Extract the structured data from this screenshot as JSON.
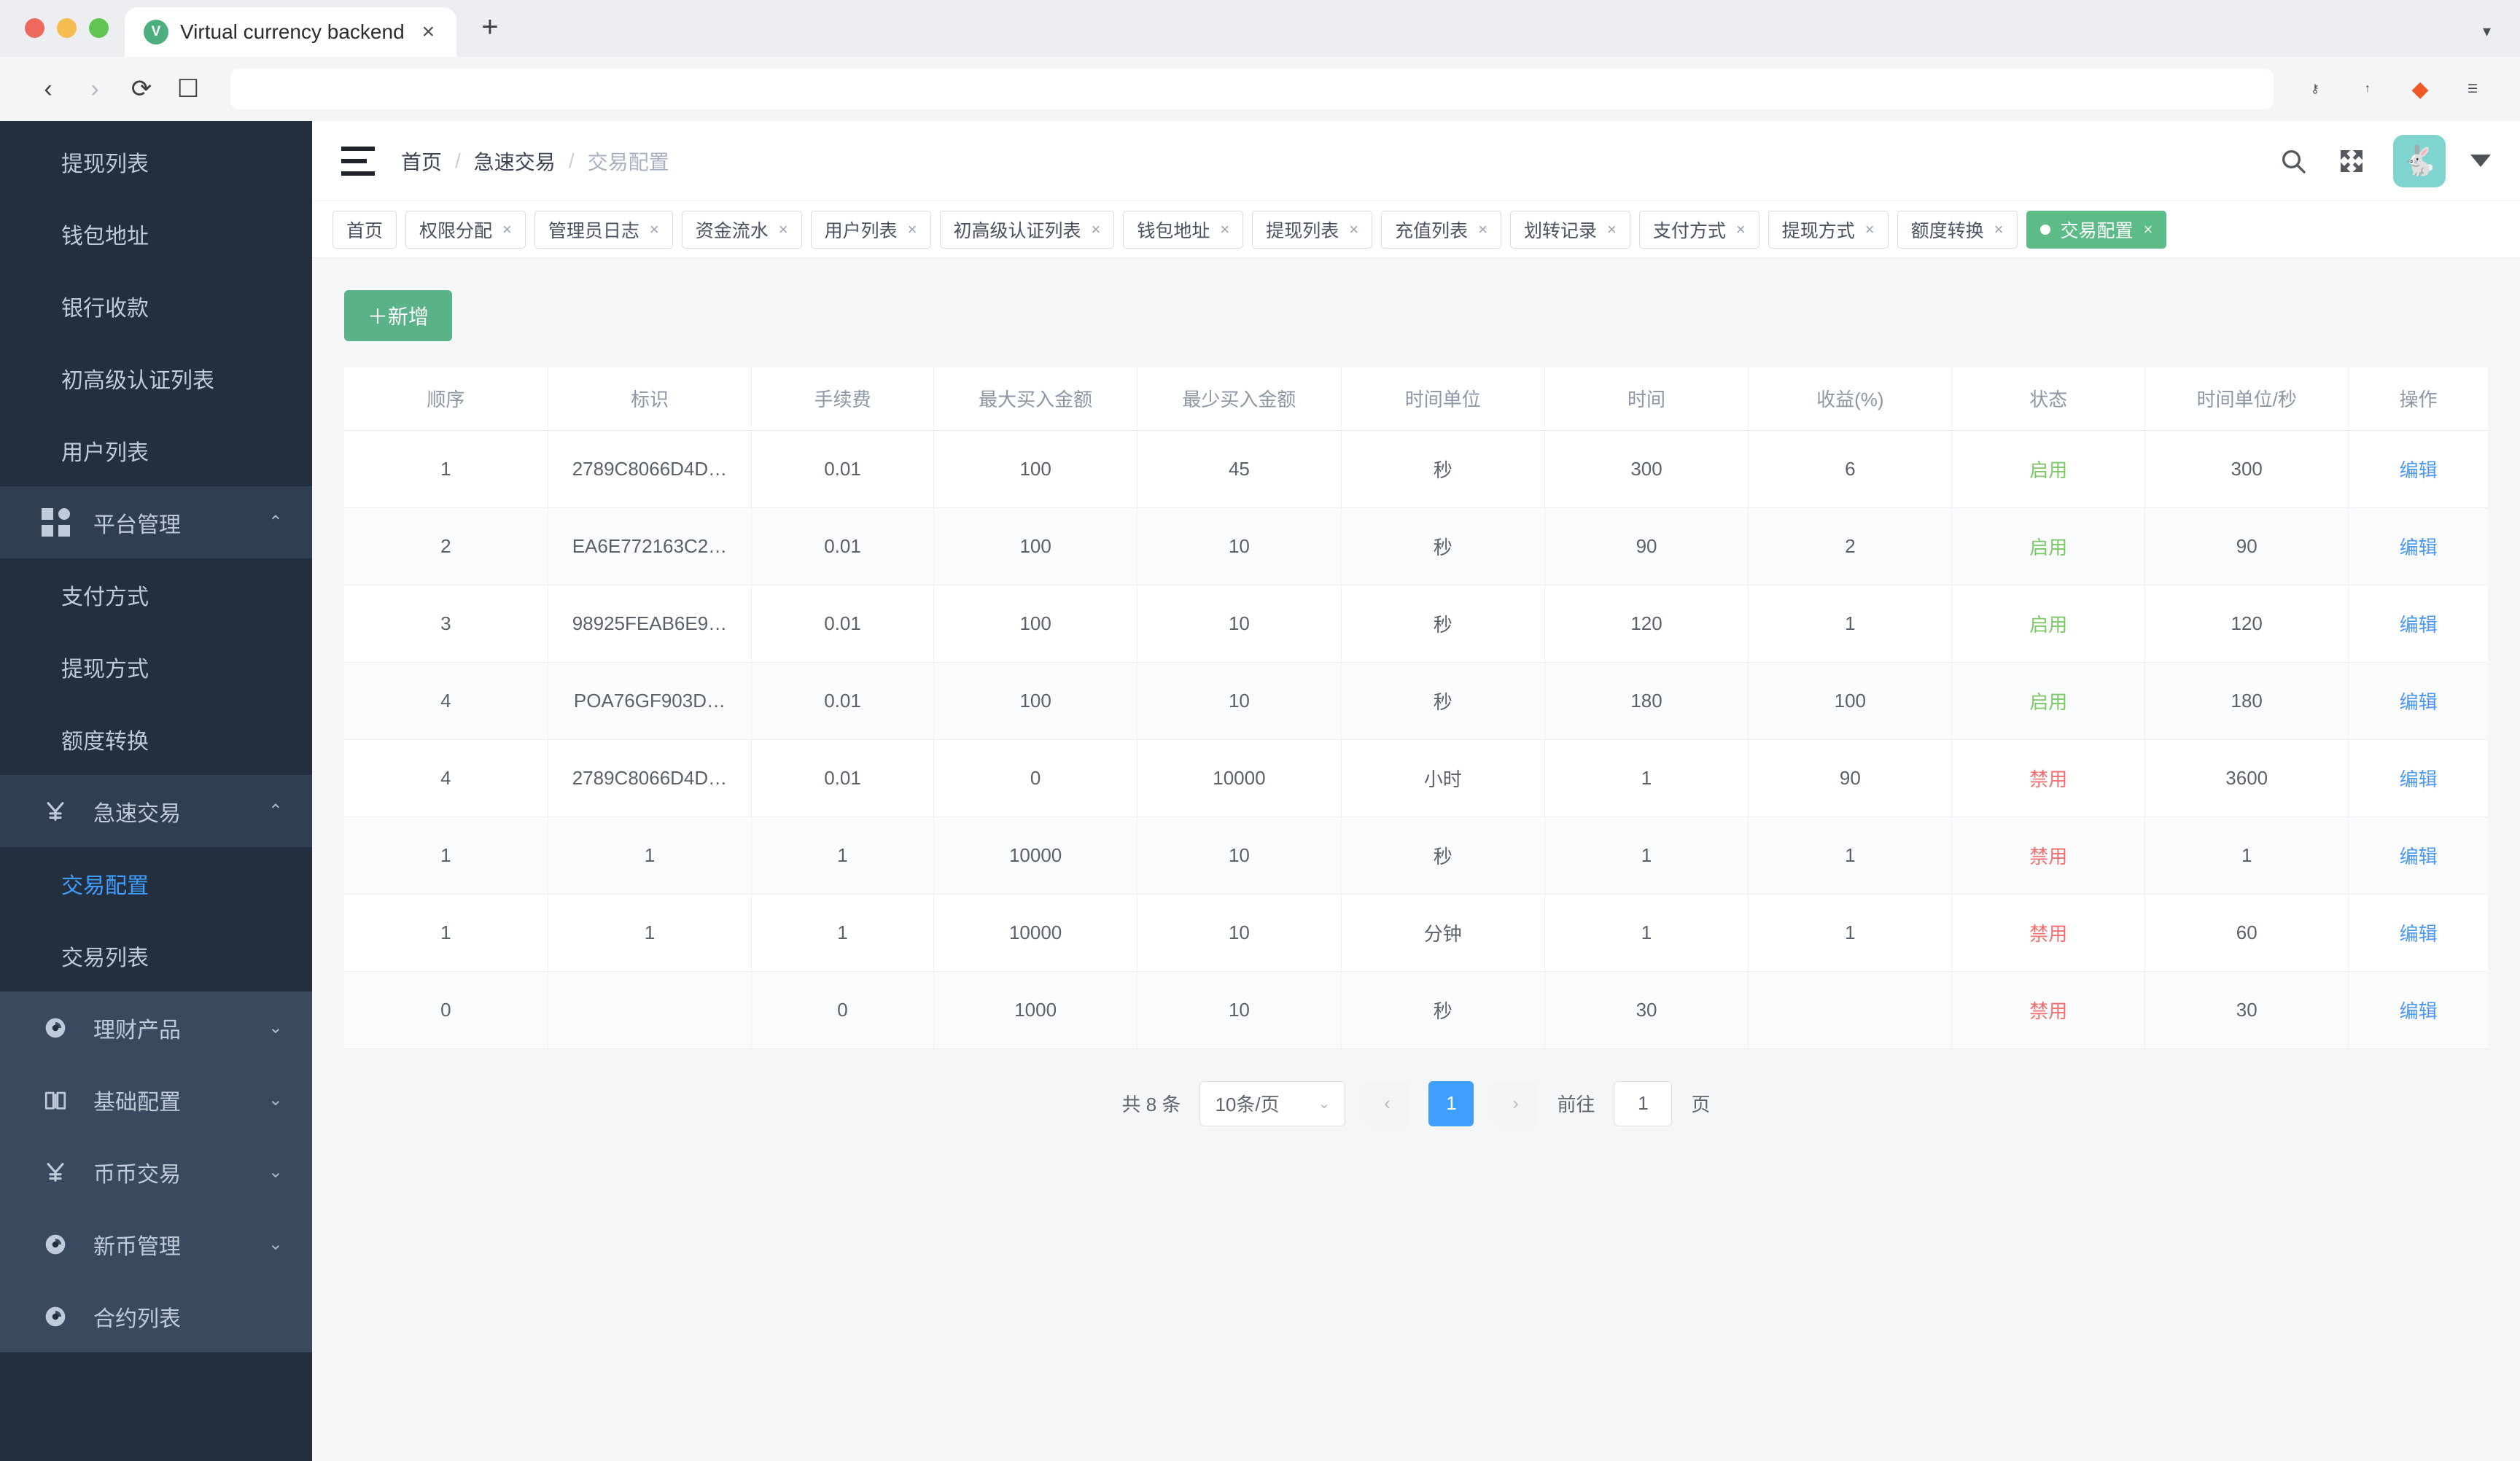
{
  "browser": {
    "tab_title": "Virtual currency backend",
    "favicon_letter": "V",
    "tab_close": "×",
    "new_tab": "+",
    "window_chevron": "▾",
    "back_icon": "‹",
    "forward_icon": "›",
    "reload_icon": "⟳",
    "bookmark_icon": "☐",
    "url_value": "",
    "key_icon": "⚷",
    "share_icon": "↑",
    "brave_icon": "◆",
    "menu_icon": "☰"
  },
  "sidebar": {
    "items": [
      {
        "label": "提现列表",
        "type": "sub"
      },
      {
        "label": "钱包地址",
        "type": "sub"
      },
      {
        "label": "银行收款",
        "type": "sub"
      },
      {
        "label": "初高级认证列表",
        "type": "sub"
      },
      {
        "label": "用户列表",
        "type": "sub"
      },
      {
        "label": "平台管理",
        "type": "group",
        "icon": "grid-icon",
        "arrow": "⌃"
      },
      {
        "label": "支付方式",
        "type": "sub"
      },
      {
        "label": "提现方式",
        "type": "sub"
      },
      {
        "label": "额度转换",
        "type": "sub"
      },
      {
        "label": "急速交易",
        "type": "group",
        "icon": "yen-icon",
        "arrow": "⌃"
      },
      {
        "label": "交易配置",
        "type": "sub",
        "active": true
      },
      {
        "label": "交易列表",
        "type": "sub"
      },
      {
        "label": "理财产品",
        "type": "group-collapsed",
        "icon": "pie-icon",
        "arrow": "⌄"
      },
      {
        "label": "基础配置",
        "type": "group-collapsed",
        "icon": "book-icon",
        "arrow": "⌄"
      },
      {
        "label": "币币交易",
        "type": "group-collapsed",
        "icon": "yen-icon",
        "arrow": "⌄"
      },
      {
        "label": "新币管理",
        "type": "group-collapsed",
        "icon": "pie-icon",
        "arrow": "⌄"
      },
      {
        "label": "合约列表",
        "type": "group-collapsed",
        "icon": "pie-icon",
        "arrow": ""
      }
    ]
  },
  "topbar": {
    "breadcrumb": [
      "首页",
      "急速交易",
      "交易配置"
    ],
    "separator": "/",
    "search_icon": "⚲",
    "fullscreen_icon": "⛶",
    "avatar_icon": "🐇",
    "avatar_color": "#7fd4d0"
  },
  "view_tabs": {
    "items": [
      {
        "label": "首页",
        "closable": false,
        "active": false
      },
      {
        "label": "权限分配",
        "closable": true,
        "active": false
      },
      {
        "label": "管理员日志",
        "closable": true,
        "active": false
      },
      {
        "label": "资金流水",
        "closable": true,
        "active": false
      },
      {
        "label": "用户列表",
        "closable": true,
        "active": false
      },
      {
        "label": "初高级认证列表",
        "closable": true,
        "active": false
      },
      {
        "label": "钱包地址",
        "closable": true,
        "active": false
      },
      {
        "label": "提现列表",
        "closable": true,
        "active": false
      },
      {
        "label": "充值列表",
        "closable": true,
        "active": false
      },
      {
        "label": "划转记录",
        "closable": true,
        "active": false
      },
      {
        "label": "支付方式",
        "closable": true,
        "active": false
      },
      {
        "label": "提现方式",
        "closable": true,
        "active": false
      },
      {
        "label": "额度转换",
        "closable": true,
        "active": false
      },
      {
        "label": "交易配置",
        "closable": true,
        "active": true
      }
    ],
    "close_glyph": "×",
    "active_color": "#5dbb87"
  },
  "toolbar": {
    "add_label": "＋新增",
    "add_color": "#5ab288"
  },
  "table": {
    "columns": [
      "顺序",
      "标识",
      "手续费",
      "最大买入金额",
      "最少买入金额",
      "时间单位",
      "时间",
      "收益(%)",
      "状态",
      "时间单位/秒",
      "操作"
    ],
    "rows": [
      {
        "order": "1",
        "id": "2789C8066D4D…",
        "fee": "0.01",
        "max_buy": "100",
        "min_buy": "45",
        "unit": "秒",
        "time": "300",
        "profit": "6",
        "status": "启用",
        "status_type": "on",
        "unit_sec": "300",
        "action": "编辑"
      },
      {
        "order": "2",
        "id": "EA6E772163C2…",
        "fee": "0.01",
        "max_buy": "100",
        "min_buy": "10",
        "unit": "秒",
        "time": "90",
        "profit": "2",
        "status": "启用",
        "status_type": "on",
        "unit_sec": "90",
        "action": "编辑"
      },
      {
        "order": "3",
        "id": "98925FEAB6E9…",
        "fee": "0.01",
        "max_buy": "100",
        "min_buy": "10",
        "unit": "秒",
        "time": "120",
        "profit": "1",
        "status": "启用",
        "status_type": "on",
        "unit_sec": "120",
        "action": "编辑"
      },
      {
        "order": "4",
        "id": "POA76GF903D…",
        "fee": "0.01",
        "max_buy": "100",
        "min_buy": "10",
        "unit": "秒",
        "time": "180",
        "profit": "100",
        "status": "启用",
        "status_type": "on",
        "unit_sec": "180",
        "action": "编辑"
      },
      {
        "order": "4",
        "id": "2789C8066D4D…",
        "fee": "0.01",
        "max_buy": "0",
        "min_buy": "10000",
        "unit": "小时",
        "time": "1",
        "profit": "90",
        "status": "禁用",
        "status_type": "off",
        "unit_sec": "3600",
        "action": "编辑"
      },
      {
        "order": "1",
        "id": "1",
        "fee": "1",
        "max_buy": "10000",
        "min_buy": "10",
        "unit": "秒",
        "time": "1",
        "profit": "1",
        "status": "禁用",
        "status_type": "off",
        "unit_sec": "1",
        "action": "编辑"
      },
      {
        "order": "1",
        "id": "1",
        "fee": "1",
        "max_buy": "10000",
        "min_buy": "10",
        "unit": "分钟",
        "time": "1",
        "profit": "1",
        "status": "禁用",
        "status_type": "off",
        "unit_sec": "60",
        "action": "编辑"
      },
      {
        "order": "0",
        "id": "",
        "fee": "0",
        "max_buy": "1000",
        "min_buy": "10",
        "unit": "秒",
        "time": "30",
        "profit": "",
        "status": "禁用",
        "status_type": "off",
        "unit_sec": "30",
        "action": "编辑"
      }
    ]
  },
  "pagination": {
    "total_label": "共 8 条",
    "page_size": "10条/页",
    "prev": "‹",
    "next": "›",
    "current_page": "1",
    "goto_label": "前往",
    "goto_value": "1",
    "page_unit": "页",
    "chevron": "⌄",
    "active_color": "#409eff"
  }
}
